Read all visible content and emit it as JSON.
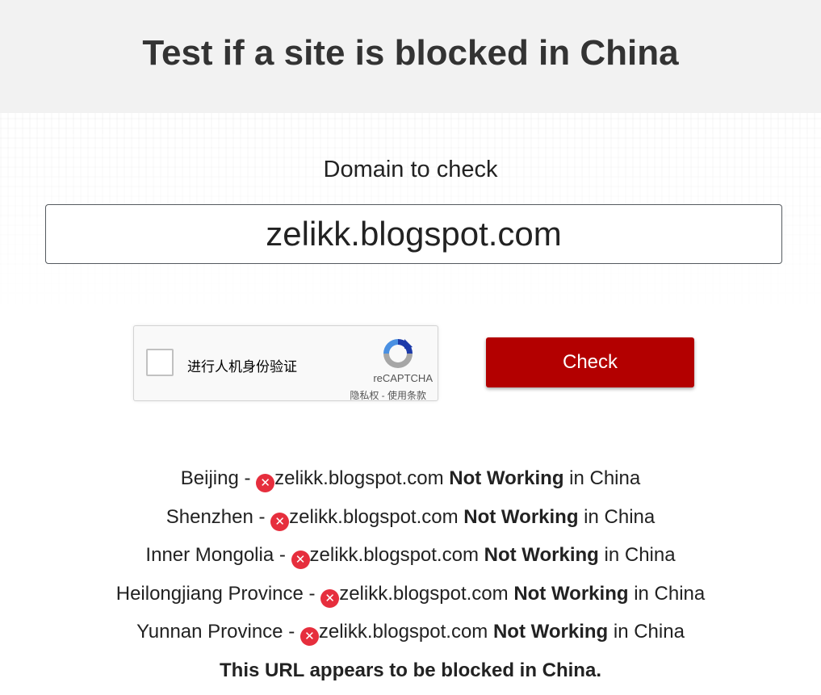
{
  "header": {
    "title": "Test if a site is blocked in China"
  },
  "form": {
    "domain_label": "Domain to check",
    "domain_value": "zelikk.blogspot.com",
    "check_label": "Check"
  },
  "recaptcha": {
    "checkbox_label": "进行人机身份验证",
    "brand": "reCAPTCHA",
    "links": "隐私权 - 使用条款"
  },
  "results": {
    "separator": " - ",
    "status_label": "Not Working",
    "suffix": " in China",
    "error_icon": "✕",
    "items": [
      {
        "location": "Beijing",
        "domain": "zelikk.blogspot.com"
      },
      {
        "location": "Shenzhen",
        "domain": "zelikk.blogspot.com"
      },
      {
        "location": "Inner Mongolia",
        "domain": "zelikk.blogspot.com"
      },
      {
        "location": "Heilongjiang Province",
        "domain": "zelikk.blogspot.com"
      },
      {
        "location": "Yunnan Province",
        "domain": "zelikk.blogspot.com"
      }
    ],
    "summary": "This URL appears to be blocked in China."
  },
  "colors": {
    "header_bg": "#f2f2f2",
    "button_bg": "#b30000",
    "error_icon": "#e62e3d",
    "text": "#222222"
  }
}
